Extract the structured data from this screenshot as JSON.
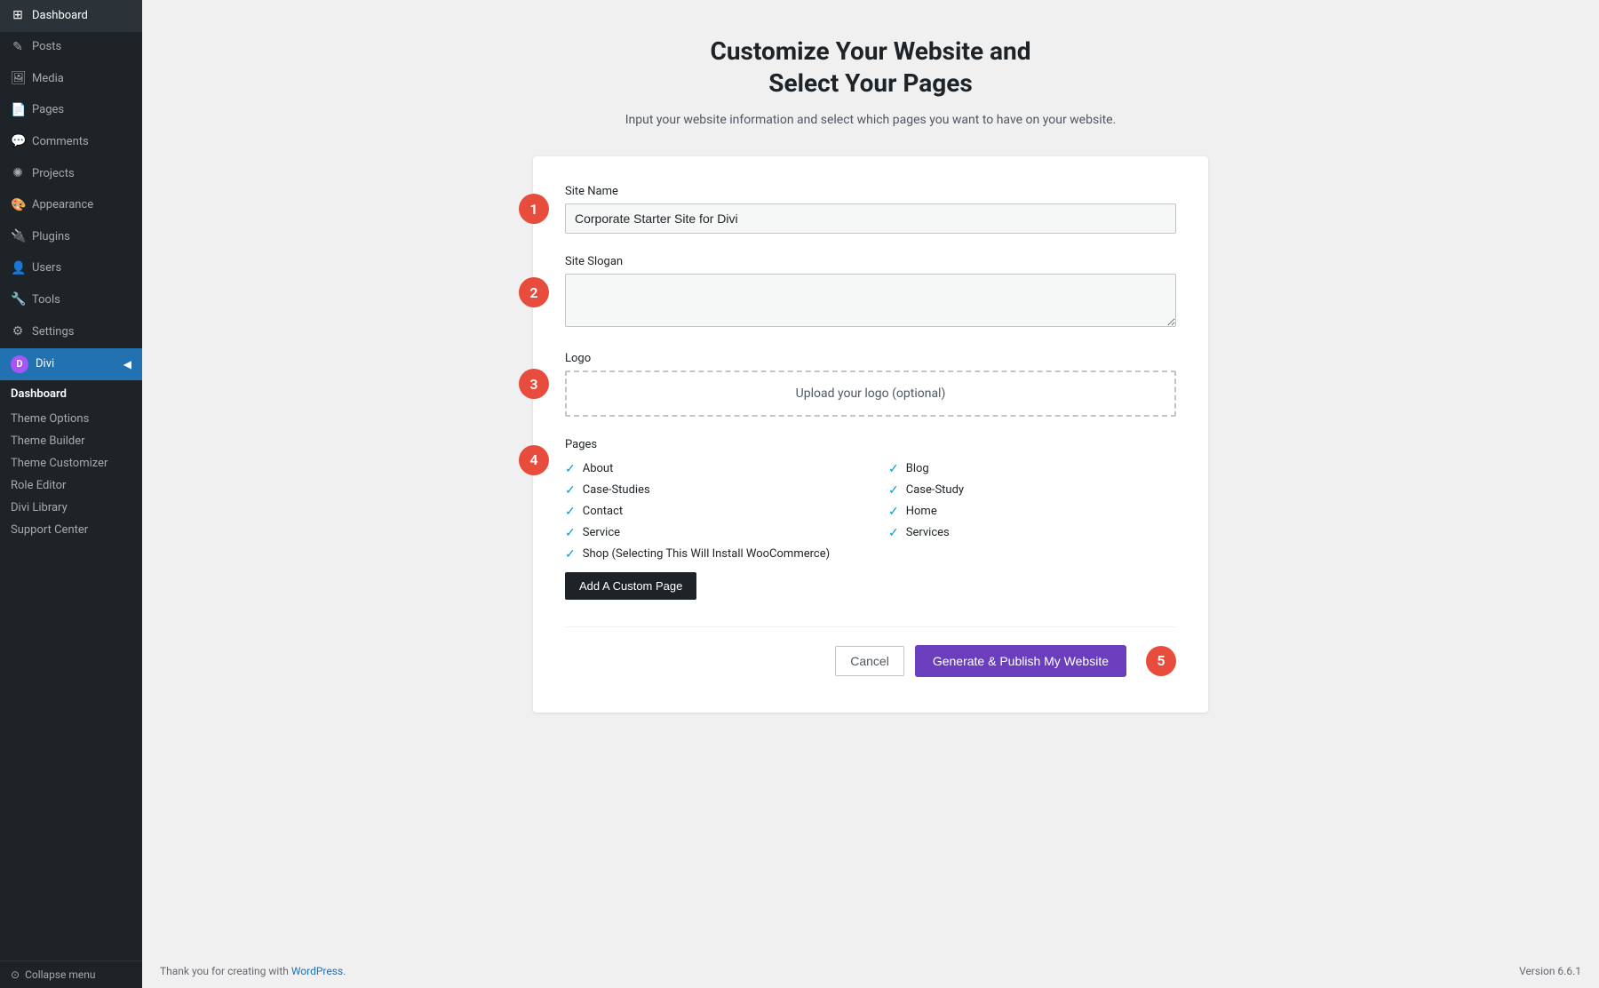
{
  "sidebar": {
    "nav_items": [
      {
        "id": "dashboard",
        "label": "Dashboard",
        "icon": "⊞"
      },
      {
        "id": "posts",
        "label": "Posts",
        "icon": "✎"
      },
      {
        "id": "media",
        "label": "Media",
        "icon": "⬜"
      },
      {
        "id": "pages",
        "label": "Pages",
        "icon": "📄"
      },
      {
        "id": "comments",
        "label": "Comments",
        "icon": "💬"
      },
      {
        "id": "projects",
        "label": "Projects",
        "icon": "✺"
      },
      {
        "id": "appearance",
        "label": "Appearance",
        "icon": "🎨"
      },
      {
        "id": "plugins",
        "label": "Plugins",
        "icon": "🔌"
      },
      {
        "id": "users",
        "label": "Users",
        "icon": "👤"
      },
      {
        "id": "tools",
        "label": "Tools",
        "icon": "🔧"
      },
      {
        "id": "settings",
        "label": "Settings",
        "icon": "⚙"
      }
    ],
    "divi": {
      "label": "Divi",
      "icon": "D",
      "submenu": {
        "dashboard_label": "Dashboard",
        "items": [
          {
            "id": "theme-options",
            "label": "Theme Options"
          },
          {
            "id": "theme-builder",
            "label": "Theme Builder"
          },
          {
            "id": "theme-customizer",
            "label": "Theme Customizer"
          },
          {
            "id": "role-editor",
            "label": "Role Editor"
          },
          {
            "id": "divi-library",
            "label": "Divi Library"
          },
          {
            "id": "support-center",
            "label": "Support Center"
          }
        ]
      }
    },
    "collapse_label": "Collapse menu"
  },
  "main": {
    "title": "Customize Your Website and\nSelect Your Pages",
    "subtitle": "Input your website information and select which pages you want to have\non your website.",
    "form": {
      "site_name_label": "Site Name",
      "site_name_value": "Corporate Starter Site for Divi",
      "site_name_placeholder": "Corporate Starter Site for Divi",
      "site_slogan_label": "Site Slogan",
      "site_slogan_value": "",
      "site_slogan_placeholder": "",
      "logo_label": "Logo",
      "logo_upload_text": "Upload your logo (optional)",
      "pages_label": "Pages",
      "pages": [
        {
          "id": "about",
          "label": "About",
          "checked": true,
          "column": 1
        },
        {
          "id": "blog",
          "label": "Blog",
          "checked": true,
          "column": 2
        },
        {
          "id": "case-studies",
          "label": "Case-Studies",
          "checked": true,
          "column": 1
        },
        {
          "id": "case-study",
          "label": "Case-Study",
          "checked": true,
          "column": 2
        },
        {
          "id": "contact",
          "label": "Contact",
          "checked": true,
          "column": 1
        },
        {
          "id": "home",
          "label": "Home",
          "checked": true,
          "column": 2
        },
        {
          "id": "service",
          "label": "Service",
          "checked": true,
          "column": 1
        },
        {
          "id": "services",
          "label": "Services",
          "checked": true,
          "column": 2
        },
        {
          "id": "shop",
          "label": "Shop (Selecting This Will Install WooCommerce)",
          "checked": true,
          "column": 1
        }
      ],
      "add_page_btn": "Add A Custom Page",
      "cancel_btn": "Cancel",
      "publish_btn": "Generate & Publish My Website"
    }
  },
  "footer": {
    "thank_you_text": "Thank you for creating with ",
    "wordpress_link": "WordPress",
    "version": "Version 6.6.1"
  },
  "steps": {
    "step1": "1",
    "step2": "2",
    "step3": "3",
    "step4": "4",
    "step5": "5"
  }
}
